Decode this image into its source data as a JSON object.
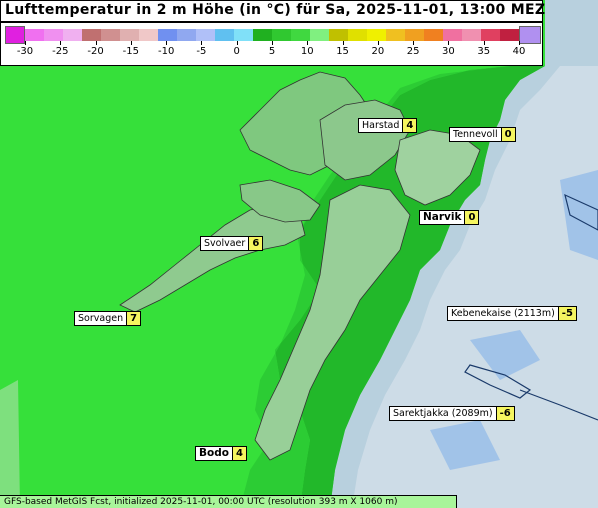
{
  "title": "Lufttemperatur in 2 m Höhe (in °C) für Sa, 2025-11-01, 13:00 MEZ",
  "scale": {
    "ticks": [
      "-30",
      "-25",
      "-20",
      "-15",
      "-10",
      "-5",
      "0",
      "5",
      "10",
      "15",
      "20",
      "25",
      "30",
      "35",
      "40"
    ],
    "colors": [
      "#f070f0",
      "#f090f0",
      "#f0b0f0",
      "#c07070",
      "#d09090",
      "#e0b0b0",
      "#f0c8c8",
      "#7090f0",
      "#90a8f0",
      "#b0c0f8",
      "#60c0f0",
      "#80e0f8",
      "#20b020",
      "#30c830",
      "#40d840",
      "#80f080",
      "#c0c000",
      "#e0e000",
      "#f0f000",
      "#f0c020",
      "#f0a020",
      "#f08020",
      "#f070a0",
      "#f090b0",
      "#e04060",
      "#c02040"
    ],
    "min_color": "#e020e0",
    "max_color": "#b090f0"
  },
  "stations": [
    {
      "name": "Harstad",
      "value": "4",
      "bold": false
    },
    {
      "name": "Tennevoll",
      "value": "0",
      "bold": false
    },
    {
      "name": "Narvik",
      "value": "0",
      "bold": true
    },
    {
      "name": "Svolvaer",
      "value": "6",
      "bold": false
    },
    {
      "name": "Sorvagen",
      "value": "7",
      "bold": false
    },
    {
      "name": "Kebenekaise (2113m)",
      "value": "-5",
      "bold": false
    },
    {
      "name": "Sarektjakka (2089m)",
      "value": "-6",
      "bold": false
    },
    {
      "name": "Bodo",
      "value": "4",
      "bold": true
    }
  ],
  "footer": "GFS-based MetGIS Fcst, initialized 2025-11-01, 00:00 UTC  (resolution 393 m X 1060 m)"
}
